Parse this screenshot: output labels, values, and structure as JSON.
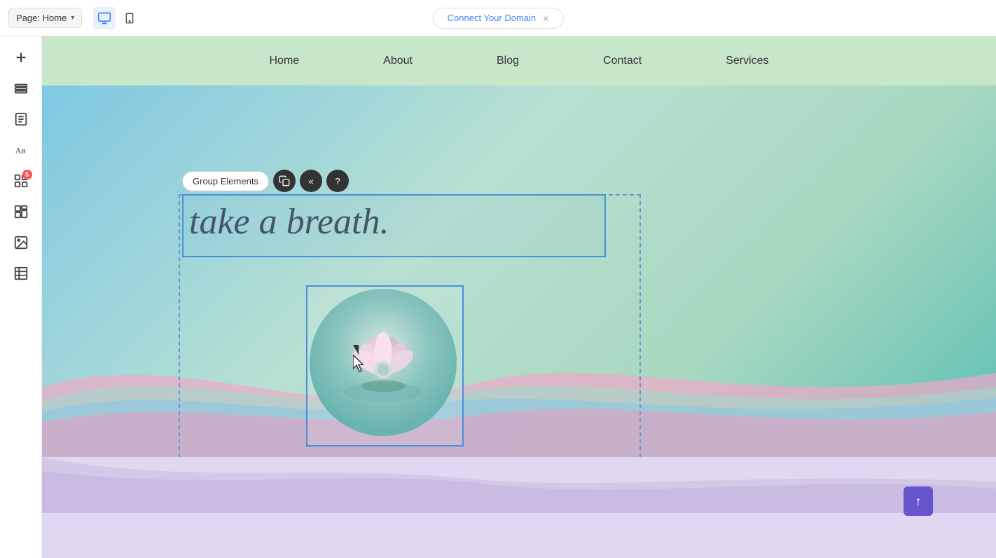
{
  "topbar": {
    "page_label": "Page: Home",
    "chevron": "▾",
    "domain_tab": "Connect Your Domain",
    "close": "×"
  },
  "devices": {
    "desktop_label": "desktop",
    "mobile_label": "mobile"
  },
  "sidebar": {
    "icons": [
      {
        "name": "add-icon",
        "symbol": "+",
        "badge": null
      },
      {
        "name": "layers-icon",
        "symbol": "≡",
        "badge": null
      },
      {
        "name": "pages-icon",
        "symbol": "☰",
        "badge": null
      },
      {
        "name": "themes-icon",
        "symbol": "Aa",
        "badge": null
      },
      {
        "name": "apps-icon",
        "symbol": "⊞",
        "badge": "5"
      },
      {
        "name": "widgets-icon",
        "symbol": "⊕",
        "badge": null
      },
      {
        "name": "media-icon",
        "symbol": "🖼",
        "badge": null
      },
      {
        "name": "table-icon",
        "symbol": "▦",
        "badge": null
      }
    ]
  },
  "nav": {
    "items": [
      "Home",
      "About",
      "Blog",
      "Contact",
      "Services"
    ]
  },
  "toolbar": {
    "group_elements_label": "Group Elements",
    "copy_icon": "⊞",
    "back_icon": "«",
    "help_icon": "?"
  },
  "hero": {
    "text": "take a breath."
  },
  "scroll_button": "↑"
}
